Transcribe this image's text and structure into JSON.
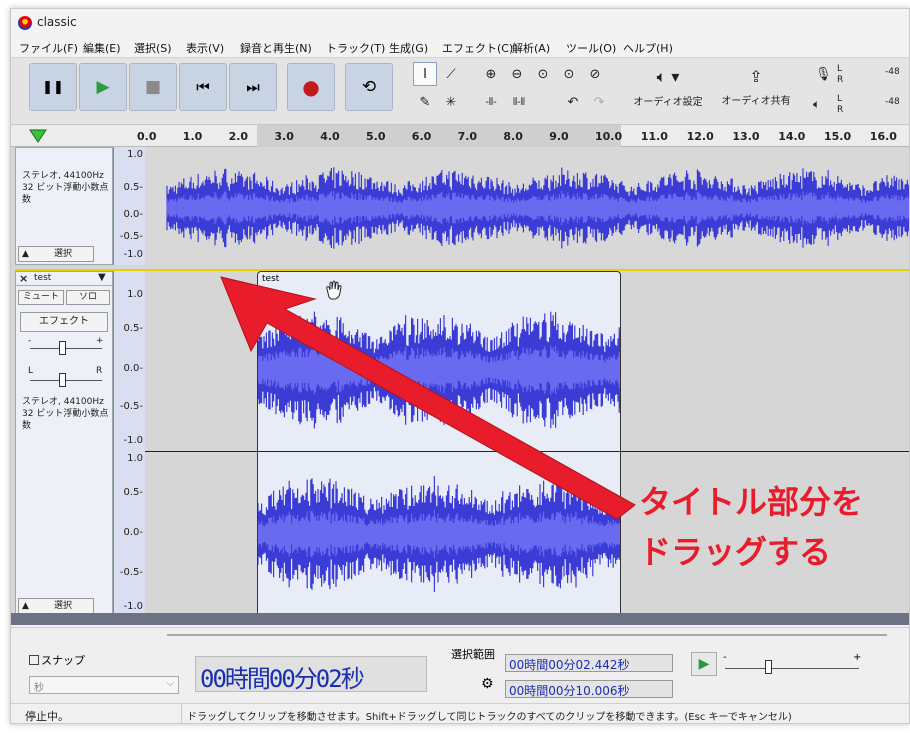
{
  "window": {
    "title": "classic"
  },
  "menu": [
    "ファイル(F)",
    "編集(E)",
    "選択(S)",
    "表示(V)",
    "録音と再生(N)",
    "トラック(T)",
    "生成(G)",
    "エフェクト(C)",
    "解析(A)",
    "ツール(O)",
    "ヘルプ(H)"
  ],
  "toolbar": {
    "pause": "❚❚",
    "play": "▶",
    "stop": "■",
    "skip_start": "⏮",
    "skip_end": "⏭",
    "record": "●",
    "loop": "⟲",
    "audio_setup_label": "オーディオ設定",
    "share_label": "オーディオ共有",
    "meter_value": "-48",
    "meter_l": "L",
    "meter_r": "R"
  },
  "ruler": {
    "ticks": [
      "0.0",
      "1.0",
      "2.0",
      "3.0",
      "4.0",
      "5.0",
      "6.0",
      "7.0",
      "8.0",
      "9.0",
      "10.0",
      "11.0",
      "12.0",
      "13.0",
      "14.0",
      "15.0",
      "16.0"
    ]
  },
  "track1": {
    "info1": "ステレオ, 44100Hz",
    "info2": "32 ビット浮動小数点数",
    "select": "選択",
    "scale": [
      "1.0",
      "0.5-",
      "0.0-",
      "-0.5-",
      "-1.0"
    ]
  },
  "track2": {
    "name": "test",
    "mute": "ミュート",
    "solo": "ソロ",
    "effects": "エフェクト",
    "gain_minus": "-",
    "gain_plus": "+",
    "pan_l": "L",
    "pan_r": "R",
    "info1": "ステレオ, 44100Hz",
    "info2": "32 ビット浮動小数点数",
    "select": "選択",
    "clip_title": "test",
    "scale_top": [
      "1.0",
      "0.5-",
      "0.0-",
      "-0.5-",
      "-1.0"
    ],
    "scale_bottom": [
      "1.0",
      "0.5-",
      "0.0-",
      "-0.5-",
      "-1.0"
    ]
  },
  "annotation": {
    "line1": "タイトル部分を",
    "line2": "ドラッグする"
  },
  "bottom": {
    "snap_label": "スナップ",
    "snap_unit": "秒",
    "time": "00時間00分02秒",
    "sel_label": "選択範囲",
    "sel_start": "00時間00分02.442秒",
    "sel_end": "00時間00分10.006秒",
    "play_at_speed_minus": "-",
    "play_at_speed_plus": "+"
  },
  "status": {
    "left": "停止中。",
    "message": "ドラッグしてクリップを移動させます。Shift+ドラッグして同じトラックのすべてのクリップを移動できます。(Esc キーでキャンセル)"
  },
  "colors": {
    "wave": "#3b3bd6",
    "wave_rms": "#6a6af0",
    "arrow": "#e81c2a",
    "track_bg": "#d8d8d8"
  }
}
